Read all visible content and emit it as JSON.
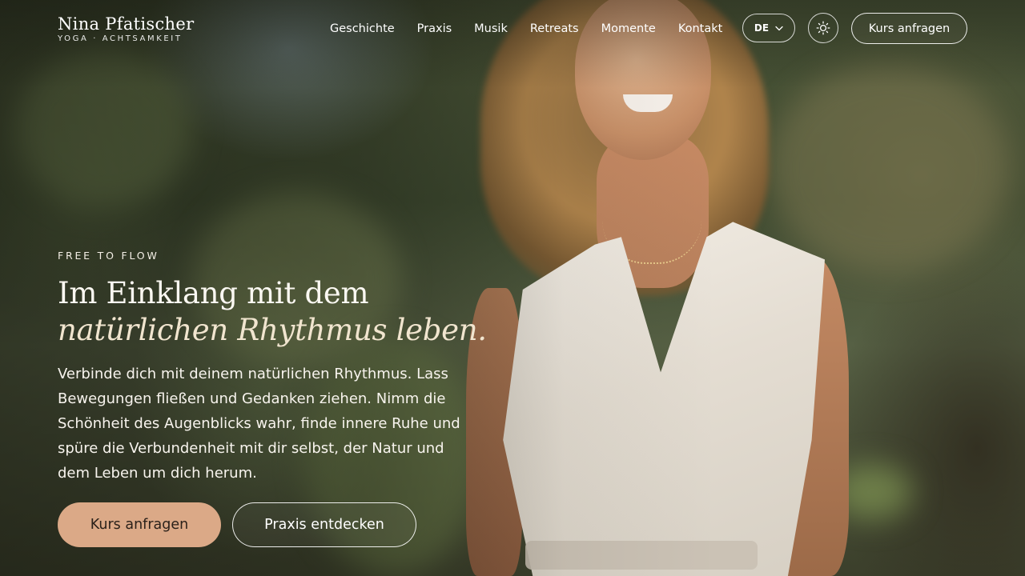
{
  "brand": {
    "name": "Nina Pfatischer",
    "tagline": "YOGA · ACHTSAMKEIT"
  },
  "nav": {
    "items": [
      {
        "label": "Geschichte"
      },
      {
        "label": "Praxis"
      },
      {
        "label": "Musik"
      },
      {
        "label": "Retreats"
      },
      {
        "label": "Momente"
      },
      {
        "label": "Kontakt"
      }
    ]
  },
  "header": {
    "language": "DE",
    "language_icon": "chevron-down-icon",
    "theme_icon": "sun-icon",
    "cta_label": "Kurs anfragen"
  },
  "hero": {
    "eyebrow": "FREE TO FLOW",
    "headline_line1": "Im Einklang mit dem",
    "headline_line2": "natürlichen Rhythmus leben.",
    "lede": "Verbinde dich mit deinem natürlichen Rhythmus. Lass Bewegungen fließen und Gedanken ziehen. Nimm die Schönheit des Augenblicks wahr, finde innere Ruhe und spüre die Verbundenheit mit dir selbst, der Natur und dem Leben um dich herum.",
    "primary_cta": "Kurs anfragen",
    "secondary_cta": "Praxis entdecken"
  },
  "colors": {
    "accent": "#dba987",
    "text": "#ffffff",
    "headline_italic": "#f1e5cf"
  }
}
